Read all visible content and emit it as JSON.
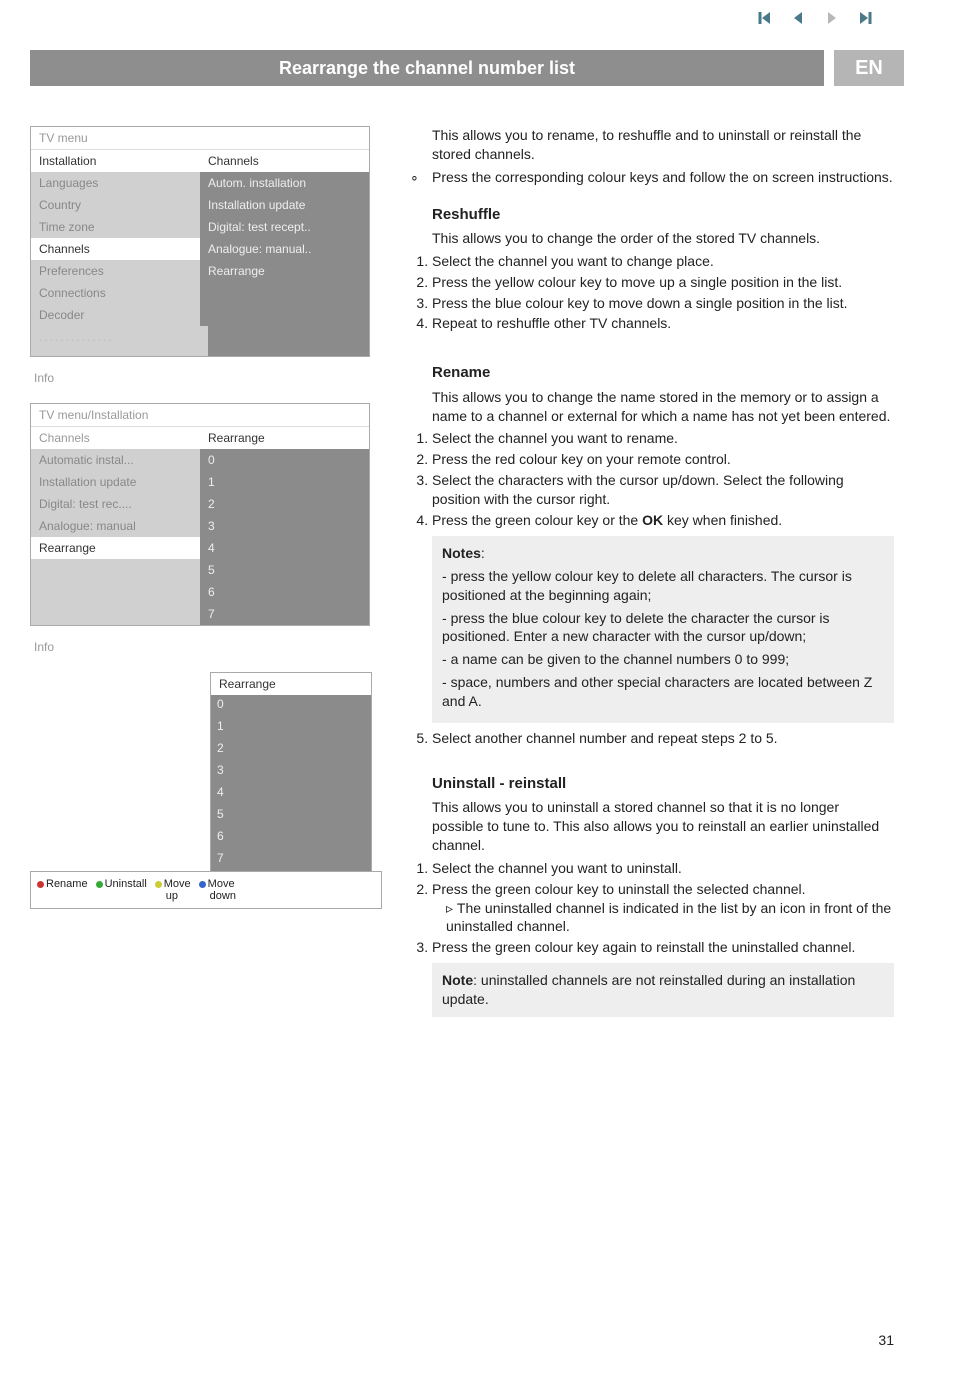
{
  "header": {
    "title": "Rearrange the channel number list",
    "lang": "EN"
  },
  "menu1": {
    "title": "TV menu",
    "col_header_left": "Installation",
    "col_header_right": "Channels",
    "rows": [
      {
        "l": "Languages",
        "r": "Autom. installation"
      },
      {
        "l": "Country",
        "r": "Installation update"
      },
      {
        "l": "Time zone",
        "r": "Digital: test recept.."
      },
      {
        "l": "Channels",
        "r": "Analogue: manual.."
      },
      {
        "l": "Preferences",
        "r": "Rearrange"
      },
      {
        "l": "Connections",
        "r": ""
      },
      {
        "l": "Decoder",
        "r": ""
      }
    ],
    "placeholder": "..............",
    "info": "Info"
  },
  "menu2": {
    "title": "TV menu/Installation",
    "col_header_left": "Channels",
    "col_header_right": "Rearrange",
    "rows": [
      {
        "l": "Automatic instal...",
        "r": "0"
      },
      {
        "l": "Installation update",
        "r": "1"
      },
      {
        "l": "Digital: test rec....",
        "r": "2"
      },
      {
        "l": "Analogue: manual",
        "r": "3"
      },
      {
        "l": "Rearrange",
        "r": "4"
      },
      {
        "l": "",
        "r": "5"
      },
      {
        "l": "",
        "r": "6"
      },
      {
        "l": "",
        "r": "7"
      }
    ],
    "info": "Info"
  },
  "menu3": {
    "header": "Rearrange",
    "rows": [
      "0",
      "1",
      "2",
      "3",
      "4",
      "5",
      "6",
      "7"
    ]
  },
  "legend": {
    "rename": "Rename",
    "uninstall": "Uninstall",
    "moveup": "Move",
    "moveup_sub": "up",
    "movedown": "Move",
    "movedown_sub": "down"
  },
  "body": {
    "intro1": "This allows you to rename, to reshuffle and to uninstall or reinstall the stored channels.",
    "intro2": "Press the corresponding colour keys and follow the on screen instructions.",
    "reshuffle": {
      "h": "Reshuffle",
      "p": "This allows you to change the order of the stored TV channels.",
      "s1": "Select the channel you want to change place.",
      "s2": "Press the yellow colour key  to move up a single position in the list.",
      "s3": "Press the blue colour key to move down a single position in the list.",
      "s4": "Repeat to reshuffle other TV channels."
    },
    "rename": {
      "h": "Rename",
      "p": "This allows you to change the name stored in the memory or to assign a name to a channel or external for which a name has not yet been entered.",
      "s1": "Select the channel you want to rename.",
      "s2": "Press the red colour key on your remote control.",
      "s3": "Select the characters with the cursor up/down. Select the following position with the cursor right.",
      "s4_a": "Press the green colour key or the ",
      "s4_key": "OK",
      "s4_b": " key when finished.",
      "notes_h": "Notes",
      "n1": "press the yellow colour key to delete all characters. The cursor is positioned at the beginning again;",
      "n2": "press the blue colour key to delete the character the cursor is positioned. Enter a new character with the cursor up/down;",
      "n3": "a name can be given to the channel numbers 0 to 999;",
      "n4": "space, numbers and other special characters are located between Z and A.",
      "s5": "Select another channel number and repeat steps 2 to 5."
    },
    "uninstall": {
      "h": "Uninstall - reinstall",
      "p": "This allows you to uninstall a stored channel so that it is no longer possible to tune to. This also allows you to reinstall an earlier uninstalled channel.",
      "s1": "Select the channel you want to uninstall.",
      "s2": "Press the green colour key to uninstall the selected channel.",
      "s2_sub": "The uninstalled channel is indicated in the list by an icon in front of the uninstalled channel.",
      "s3": "Press the green colour key again to reinstall the uninstalled channel.",
      "note_h": "Note",
      "note": ": uninstalled channels are not reinstalled during an installation update."
    }
  },
  "pagenum": "31"
}
